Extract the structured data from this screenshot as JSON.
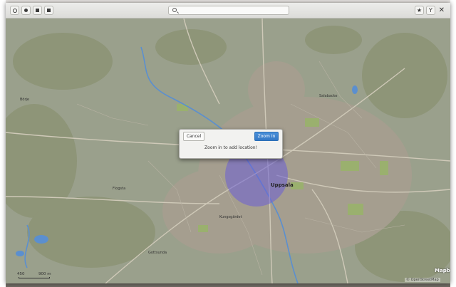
{
  "window": {
    "search_placeholder": "",
    "buttons": [
      {
        "name": "location-button"
      },
      {
        "name": "layer-button"
      },
      {
        "name": "favorite-place-button"
      },
      {
        "name": "print-button"
      }
    ]
  },
  "map": {
    "city_label": "Uppsala",
    "labels": [
      {
        "text": "Börje",
        "size": "small"
      },
      {
        "text": "Flogsta",
        "size": "small"
      },
      {
        "text": "Kungsgärdet",
        "size": "small"
      },
      {
        "text": "Salabacke",
        "size": "small"
      },
      {
        "text": "Gottsunda",
        "size": "small"
      }
    ],
    "scale": {
      "left_label": "450",
      "right_label": "900 m"
    },
    "logo": "Mapbox",
    "copyright": "© OpenStreetMap",
    "location_circle_color": "#6b5fd6"
  },
  "dialog": {
    "cancel_label": "Cancel",
    "zoom_label": "Zoom In",
    "message": "Zoom in to add location!"
  }
}
